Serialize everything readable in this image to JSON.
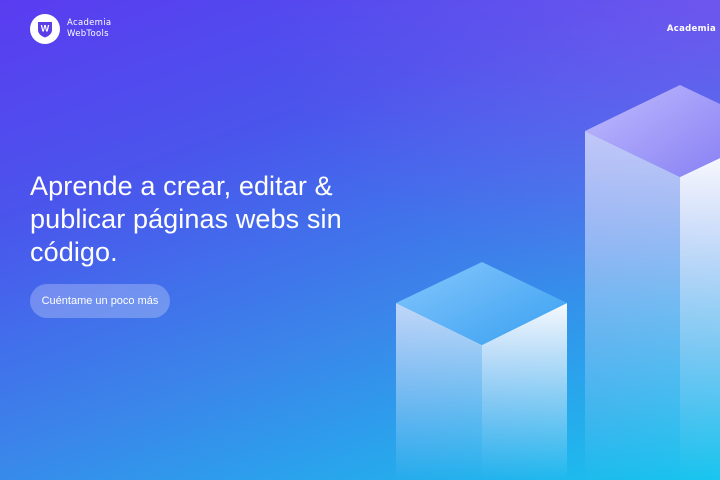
{
  "brand": {
    "badge_letter": "W",
    "name_line1": "Academia",
    "name_line2": "WebTools"
  },
  "nav": {
    "link_label": "Academia"
  },
  "hero": {
    "headline": "Aprende a crear, editar & publicar páginas webs sin código.",
    "cta_label": "Cuéntame un poco más"
  },
  "colors": {
    "gradient_top": "#5a3cf0",
    "gradient_bottom": "#17c6ee",
    "text": "#ffffff",
    "badge_letter": "#5b3ee8"
  }
}
